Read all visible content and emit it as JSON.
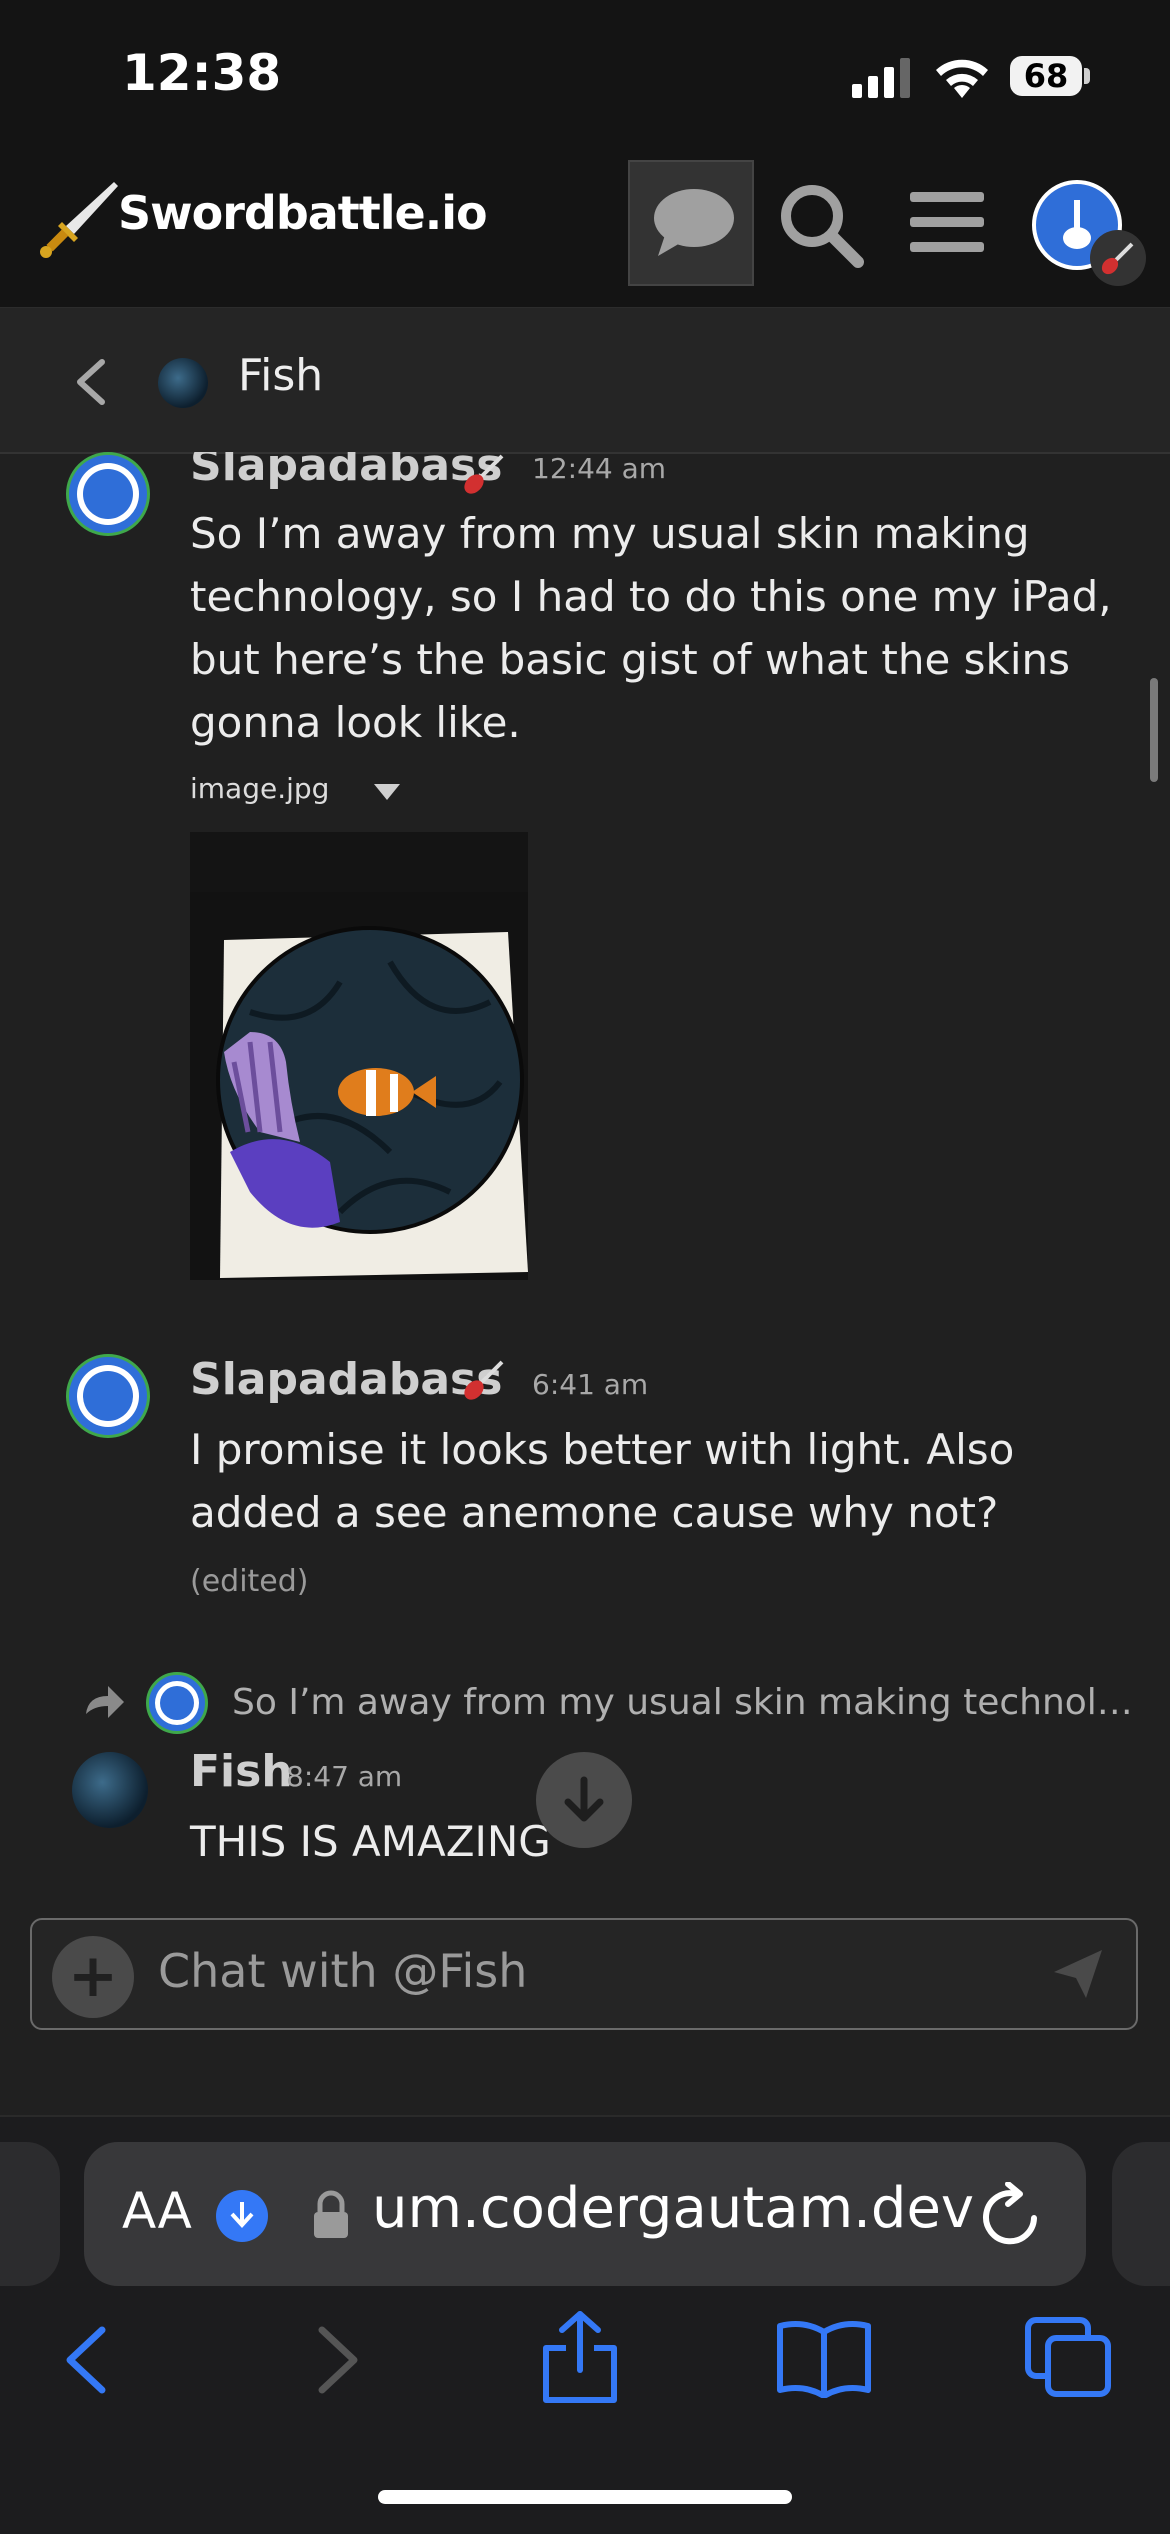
{
  "status_bar": {
    "time": "12:38",
    "battery": "68"
  },
  "site": {
    "brand": "Swordbattle.io"
  },
  "chat": {
    "title": "Fish",
    "messages": [
      {
        "user": "Slapadabass",
        "time": "12:44 am",
        "lines": [
          "So I’m away from my usual skin making",
          "technology, so I had to do this one my iPad,",
          "but here’s the basic gist of what the skins",
          "gonna look like."
        ],
        "attachment": "image.jpg"
      },
      {
        "user": "Slapadabass",
        "time": "6:41 am",
        "lines": [
          "I promise it looks better with light. Also",
          "added a see anemone cause why not?"
        ],
        "edited": "(edited)"
      },
      {
        "reply_preview": "So I’m away from my usual skin making technol…",
        "user": "Fish",
        "time": "8:47 am",
        "lines": [
          "THIS IS AMAZING"
        ]
      }
    ],
    "input_placeholder": "Chat with @Fish"
  },
  "browser": {
    "text_size_label": "AA",
    "url": "um.codergautam.dev"
  },
  "colors": {
    "accent_blue": "#3478f6",
    "bg": "#202020",
    "online_ring": "#3fa84b"
  }
}
